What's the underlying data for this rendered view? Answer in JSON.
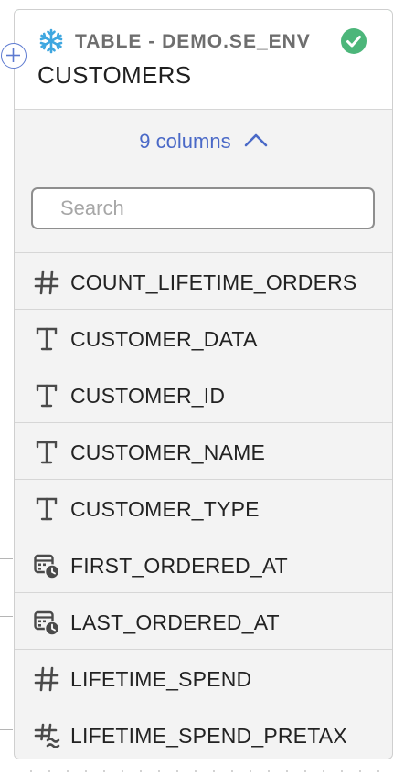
{
  "node": {
    "source_label": "TABLE - DEMO.SE_ENV",
    "title": "CUSTOMERS",
    "status": "success",
    "colors": {
      "accent": "#4a69c7",
      "success": "#4cb67a",
      "snowflake": "#3fa7e0"
    }
  },
  "columns_toggle": {
    "label": "9 columns"
  },
  "search": {
    "placeholder": "Search",
    "value": ""
  },
  "columns": [
    {
      "name": "COUNT_LIFETIME_ORDERS",
      "icon": "number-icon"
    },
    {
      "name": "CUSTOMER_DATA",
      "icon": "text-type-icon"
    },
    {
      "name": "CUSTOMER_ID",
      "icon": "text-type-icon"
    },
    {
      "name": "CUSTOMER_NAME",
      "icon": "text-type-icon"
    },
    {
      "name": "CUSTOMER_TYPE",
      "icon": "text-type-icon"
    },
    {
      "name": "FIRST_ORDERED_AT",
      "icon": "datetime-icon"
    },
    {
      "name": "LAST_ORDERED_AT",
      "icon": "datetime-icon"
    },
    {
      "name": "LIFETIME_SPEND",
      "icon": "number-icon"
    },
    {
      "name": "LIFETIME_SPEND_PRETAX",
      "icon": "approx-number-icon"
    }
  ]
}
